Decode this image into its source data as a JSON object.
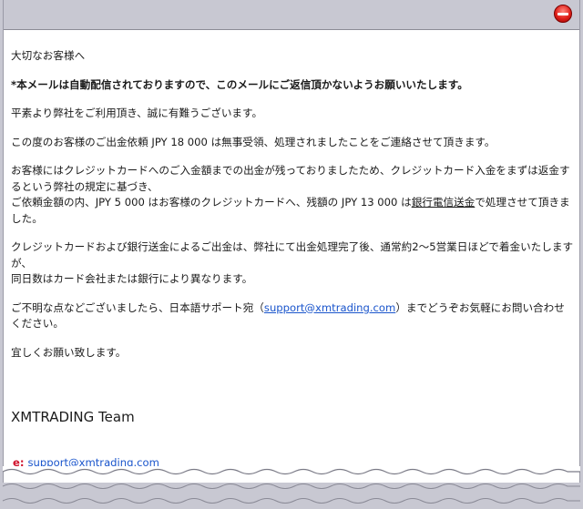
{
  "email": {
    "greeting": "大切なお客様へ",
    "notice": "*本メールは自動配信されておりますので、このメールにご返信頂かないようお願いいたします。",
    "para1": "平素より弊社をご利用頂き、誠に有難うございます。",
    "para2": "この度のお客様のご出金依頼 JPY 18 000 は無事受領、処理されましたことをご連絡させて頂きます。",
    "para3_part1": "お客様にはクレジットカードへのご入金額までの出金が残っておりましたため、クレジットカード入金をまずは返金するという弊社の規定に基づき、",
    "para3_part2_before": "ご依頼金額の内、JPY 5 000 はお客様のクレジットカードへ、残額の JPY 13 000 は",
    "para3_underlined": "銀行電信送金",
    "para3_part2_after": "で処理させて頂きました。",
    "para4_part1": "クレジットカードおよび銀行送金によるご出金は、弊社にて出金処理完了後、通常約2～5営業日ほどで着金いたしますが、",
    "para4_part2": "同日数はカード会社または銀行により異なります。",
    "para5_before": "ご不明な点などございましたら、日本語サポート宛（",
    "para5_link": "support@xmtrading.com",
    "para5_after": "）までどうぞお気軽にお問い合わせください。",
    "closing": "宜しくお願い致します。",
    "signature_team": "XMTRADING Team",
    "email_prefix": "e:",
    "email_link": "support@xmtrading.com"
  },
  "colors": {
    "link": "#1a55cc",
    "accent": "#d0102a",
    "chrome": "#c8c8d2"
  },
  "icons": {
    "close": "close-circle-icon"
  }
}
